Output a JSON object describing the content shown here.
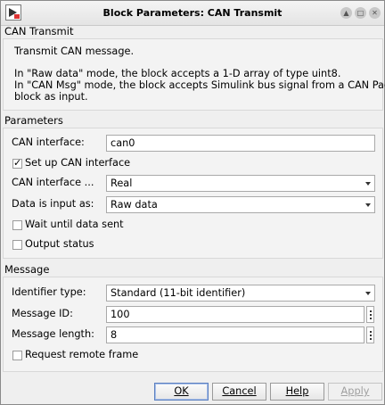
{
  "window": {
    "title": "Block Parameters: CAN Transmit",
    "controls": [
      "up-arrow-icon",
      "restore-icon",
      "close-icon"
    ]
  },
  "block": {
    "name": "CAN Transmit",
    "description": [
      "Transmit CAN message.",
      "In \"Raw data\" mode, the block accepts a 1-D array of type uint8.",
      "In \"CAN Msg\" mode, the block accepts Simulink bus signal from a CAN Pack",
      "block as input."
    ]
  },
  "parameters": {
    "header": "Parameters",
    "can_interface": {
      "label": "CAN interface:",
      "value": "can0"
    },
    "setup_can": {
      "label": "Set up CAN interface",
      "checked": true
    },
    "can_interface_type": {
      "label": "CAN interface ...",
      "value": "Real"
    },
    "data_input": {
      "label": "Data is input as:",
      "value": "Raw data"
    },
    "wait_sent": {
      "label": "Wait until data sent",
      "checked": false
    },
    "output_status": {
      "label": "Output status",
      "checked": false
    }
  },
  "message": {
    "header": "Message",
    "identifier_type": {
      "label": "Identifier type:",
      "value": "Standard (11-bit identifier)"
    },
    "message_id": {
      "label": "Message ID:",
      "value": "100"
    },
    "message_length": {
      "label": "Message length:",
      "value": "8"
    },
    "remote_frame": {
      "label": "Request remote frame",
      "checked": false
    }
  },
  "buttons": {
    "ok": "OK",
    "cancel": "Cancel",
    "help": "Help",
    "apply": "Apply"
  }
}
